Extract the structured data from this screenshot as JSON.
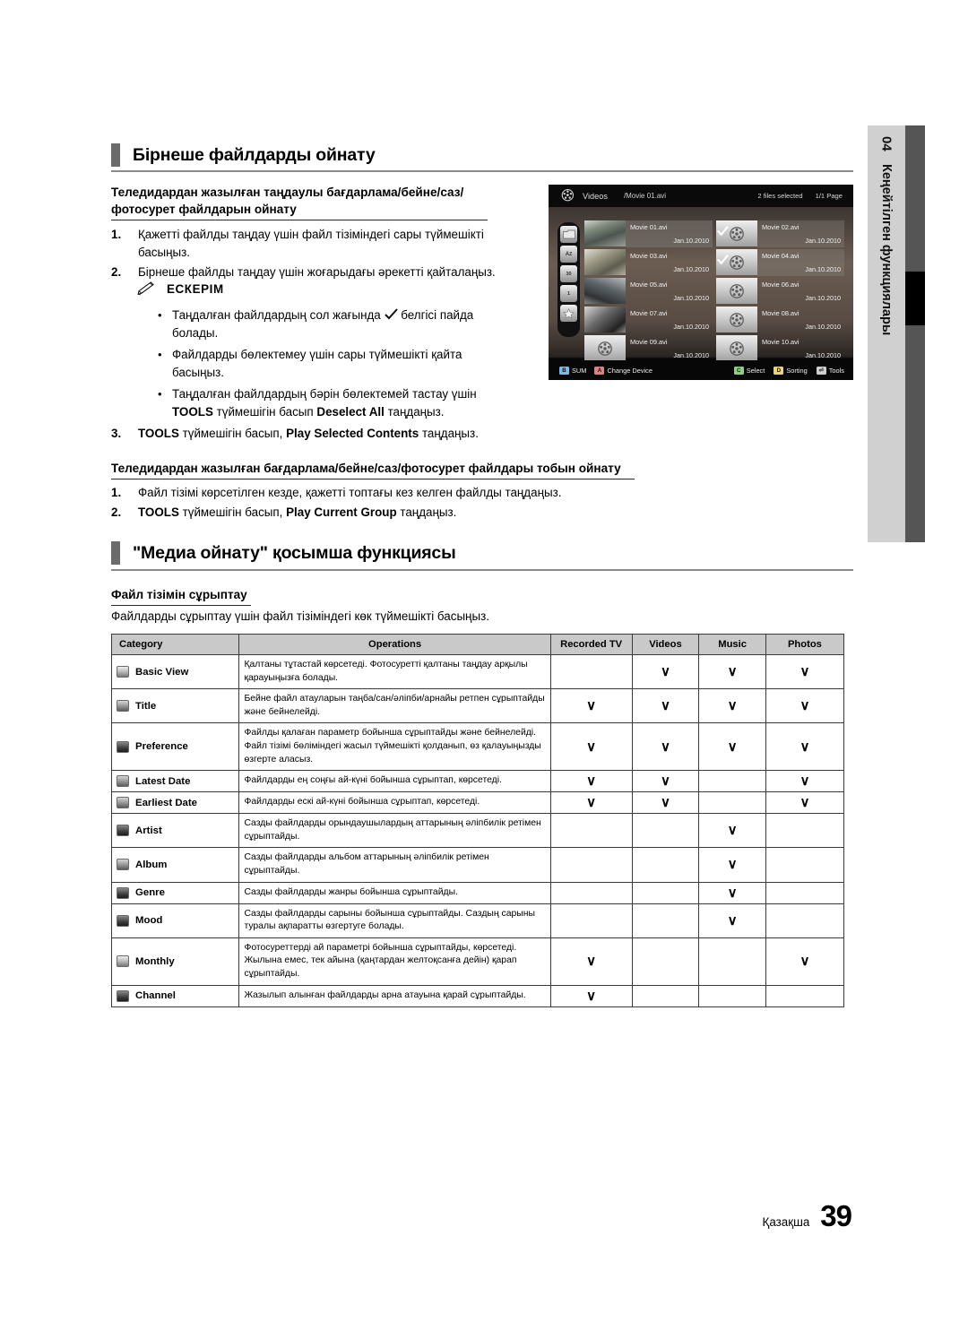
{
  "edge": {
    "chapter": "04",
    "label": "Кеңейтілген функциялары"
  },
  "section1": {
    "title": "Бірнеше файлдарды ойнату",
    "sub1": "Теледидардан жазылған таңдаулы бағдарлама/бейне/саз/\nфотосурет файлдарын ойнату",
    "sub1_line1": "Теледидардан жазылған таңдаулы бағдарлама/бейне/саз/",
    "sub1_line2": "фотосурет файлдарын ойнату",
    "step1_num": "1.",
    "step1_text": "Қажетті файлды таңдау үшін файл тізіміндегі сары түймешікті басыңыз.",
    "step2_num": "2.",
    "step2_text": "Бірнеше файлды таңдау үшін жоғарыдағы әрекетті қайталаңыз.",
    "note_title": "ЕСКЕРІМ",
    "note_items": [
      {
        "pre": "Таңдалған файлдардың сол жағында",
        "post": "белгісі пайда болады.",
        "has_tick": true
      },
      {
        "pre": "Файлдарды бөлектемеу үшін сары түймешікті қайта басыңыз.",
        "post": "",
        "has_tick": false
      },
      {
        "pre": "Таңдалған файлдардың бәрін бөлектемей тастау үшін",
        "bold1": "TOOLS",
        "mid": "түймешігін басып",
        "bold2": "Deselect All",
        "post": "таңдаңыз.",
        "has_tick": false
      }
    ],
    "step3_num": "3.",
    "step3_b1": "TOOLS",
    "step3_mid": "түймешігін басып,",
    "step3_b2": "Play Selected Contents",
    "step3_end": "таңдаңыз.",
    "sub2": "Теледидардан жазылған бағдарлама/бейне/саз/фотосурет файлдары тобын ойнату",
    "g_step1_num": "1.",
    "g_step1_text": "Файл тізімі көрсетілген кезде, қажетті топтағы кез келген файлды таңдаңыз.",
    "g_step2_num": "2.",
    "g_step2_b1": "TOOLS",
    "g_step2_mid": "түймешігін басып,",
    "g_step2_b2": "Play Current Group",
    "g_step2_end": "таңдаңыз."
  },
  "section2": {
    "title": "\"Медиа ойнату\" қосымша функциясы",
    "sub1": "Файл тізімін сұрыптау",
    "intro": "Файлдарды сұрыптау үшін файл тізіміндегі көк түймешікті басыңыз."
  },
  "tv": {
    "app": "Videos",
    "path": "/Movie 01.avi",
    "selected": "2 files selected",
    "page": "1/1 Page",
    "files": [
      {
        "name": "Movie 01.avi",
        "date": "Jan.10.2010",
        "thumb": "photo1",
        "selected": false,
        "highlight": true
      },
      {
        "name": "Movie 02.avi",
        "date": "Jan.10.2010",
        "thumb": "reel",
        "selected": true,
        "highlight": false
      },
      {
        "name": "Movie 03.avi",
        "date": "Jan.10.2010",
        "thumb": "photo2",
        "selected": false,
        "highlight": false
      },
      {
        "name": "Movie 04.avi",
        "date": "Jan.10.2010",
        "thumb": "reel",
        "selected": true,
        "highlight": false
      },
      {
        "name": "Movie 05.avi",
        "date": "Jan.10.2010",
        "thumb": "photo3",
        "selected": false,
        "highlight": false
      },
      {
        "name": "Movie 06.avi",
        "date": "Jan.10.2010",
        "thumb": "reel",
        "selected": false,
        "highlight": false
      },
      {
        "name": "Movie 07.avi",
        "date": "Jan.10.2010",
        "thumb": "photo4",
        "selected": false,
        "highlight": false
      },
      {
        "name": "Movie 08.avi",
        "date": "Jan.10.2010",
        "thumb": "reel",
        "selected": false,
        "highlight": false
      },
      {
        "name": "Movie 09.avi",
        "date": "Jan.10.2010",
        "thumb": "reel",
        "selected": false,
        "highlight": false
      },
      {
        "name": "Movie 10.avi",
        "date": "Jan.10.2010",
        "thumb": "reel",
        "selected": false,
        "highlight": false
      }
    ],
    "sidebar_icons": [
      "folder-icon",
      "az-sort-icon",
      "calendar-30-icon",
      "calendar-1-icon",
      "star-icon"
    ],
    "footer_left": [
      {
        "key": "B",
        "color": "k-blue",
        "label": "SUM"
      },
      {
        "key": "A",
        "color": "k-red",
        "label": "Change Device"
      }
    ],
    "footer_right": [
      {
        "key": "C",
        "color": "k-green",
        "label": "Select"
      },
      {
        "key": "D",
        "color": "k-yellow",
        "label": "Sorting"
      },
      {
        "key": "T",
        "color": "k-grey",
        "label": "Tools"
      }
    ]
  },
  "table": {
    "headers": [
      "Category",
      "Operations",
      "Recorded TV",
      "Videos",
      "Music",
      "Photos"
    ],
    "rows": [
      {
        "category": "Basic View",
        "icon": "folder-icon",
        "icon_style": "",
        "operations": "Қалтаны тұтастай көрсетеді. Фотосуретті қалтаны таңдау арқылы қарауыңызға болады.",
        "recorded_tv": false,
        "videos": true,
        "music": true,
        "photos": true
      },
      {
        "category": "Title",
        "icon": "az-sort-icon",
        "icon_style": "mid",
        "operations": "Бейне файл атауларын таңба/сан/әліпби/арнайы ретпен сұрыптайды және бейнелейді.",
        "recorded_tv": true,
        "videos": true,
        "music": true,
        "photos": true
      },
      {
        "category": "Preference",
        "icon": "star-icon",
        "icon_style": "dark",
        "operations": "Файлды қалаған параметр бойынша сұрыптайды және бейнелейді. Файл тізімі бөліміндегі жасыл түймешікті қолданып, өз қалауыңызды өзгерте аласыз.",
        "recorded_tv": true,
        "videos": true,
        "music": true,
        "photos": true
      },
      {
        "category": "Latest Date",
        "icon": "calendar-30-icon",
        "icon_style": "mid",
        "operations": "Файлдарды ең соңғы ай-күні бойынша сұрыптап, көрсетеді.",
        "recorded_tv": true,
        "videos": true,
        "music": false,
        "photos": true
      },
      {
        "category": "Earliest Date",
        "icon": "calendar-1-icon",
        "icon_style": "mid",
        "operations": "Файлдарды ескі ай-күні бойынша сұрыптап, көрсетеді.",
        "recorded_tv": true,
        "videos": true,
        "music": false,
        "photos": true
      },
      {
        "category": "Artist",
        "icon": "artist-icon",
        "icon_style": "dark",
        "operations": "Сазды файлдарды орындаушылардың аттарының әліпбилік ретімен сұрыптайды.",
        "recorded_tv": false,
        "videos": false,
        "music": true,
        "photos": false
      },
      {
        "category": "Album",
        "icon": "album-icon",
        "icon_style": "mid",
        "operations": "Сазды файлдарды альбом аттарының әліпбилік ретімен сұрыптайды.",
        "recorded_tv": false,
        "videos": false,
        "music": true,
        "photos": false
      },
      {
        "category": "Genre",
        "icon": "genre-icon",
        "icon_style": "dark",
        "operations": "Сазды файлдарды жанры бойынша сұрыптайды.",
        "recorded_tv": false,
        "videos": false,
        "music": true,
        "photos": false
      },
      {
        "category": "Mood",
        "icon": "mood-icon",
        "icon_style": "dark",
        "operations": "Сазды файлдарды сарыны бойынша сұрыптайды. Саздың сарыны туралы ақпаратты өзгертуге болады.",
        "recorded_tv": false,
        "videos": false,
        "music": true,
        "photos": false
      },
      {
        "category": "Monthly",
        "icon": "calendar-month-icon",
        "icon_style": "",
        "operations": "Фотосуреттерді ай параметрі бойынша сұрыптайды, көрсетеді. Жылына емес, тек айына (қаңтардан желтоқсанға дейін) қарап сұрыптайды.",
        "recorded_tv": true,
        "videos": false,
        "music": false,
        "photos": true
      },
      {
        "category": "Channel",
        "icon": "channel-icon",
        "icon_style": "dark",
        "operations": "Жазылып алынған файлдарды арна атауына қарай сұрыптайды.",
        "recorded_tv": true,
        "videos": false,
        "music": false,
        "photos": false
      }
    ],
    "check_glyph": "∨"
  },
  "footer": {
    "language": "Қазақша",
    "page": "39"
  }
}
